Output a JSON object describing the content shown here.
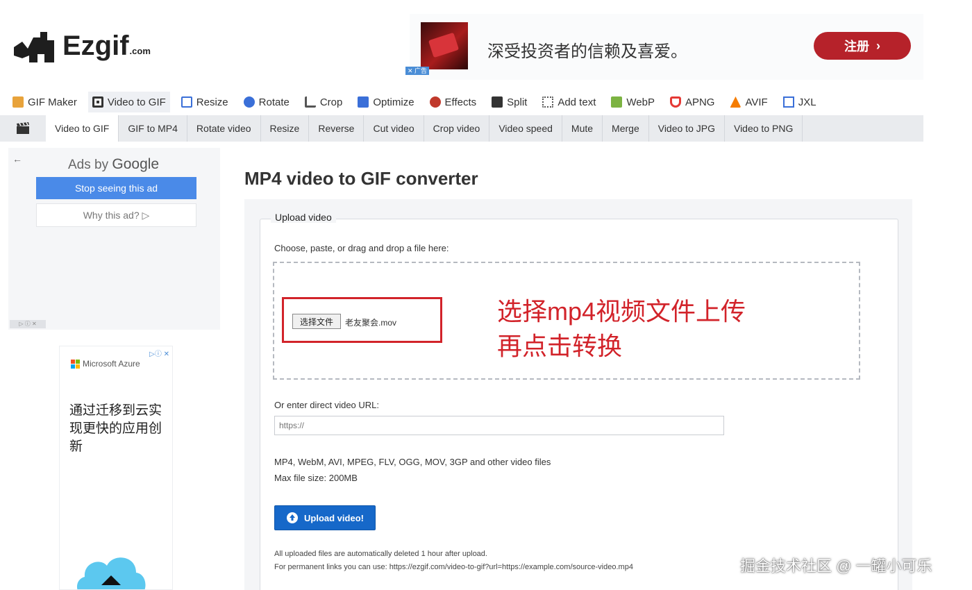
{
  "logo": {
    "name": "Ezgif",
    "suffix": ".com"
  },
  "top_ad": {
    "adchoice": "✕ 广告",
    "text": "深受投资者的信赖及喜爱。",
    "cta": "注册",
    "cta_arrow": "›",
    "cta_color": "#b6222a"
  },
  "main_nav": {
    "items": [
      {
        "label": "GIF Maker",
        "icon": "gif-maker-icon",
        "color": "#e8a33b"
      },
      {
        "label": "Video to GIF",
        "icon": "film-icon",
        "color": "#333333"
      },
      {
        "label": "Resize",
        "icon": "resize-icon",
        "color": "#3a6fd8"
      },
      {
        "label": "Rotate",
        "icon": "rotate-icon",
        "color": "#3a6fd8"
      },
      {
        "label": "Crop",
        "icon": "crop-icon",
        "color": "#555555"
      },
      {
        "label": "Optimize",
        "icon": "optimize-icon",
        "color": "#3a6fd8"
      },
      {
        "label": "Effects",
        "icon": "effects-icon",
        "color": "#c0392b"
      },
      {
        "label": "Split",
        "icon": "split-icon",
        "color": "#333333"
      },
      {
        "label": "Add text",
        "icon": "add-text-icon",
        "color": "#555555"
      },
      {
        "label": "WebP",
        "icon": "webp-icon",
        "color": "#7cb342"
      },
      {
        "label": "APNG",
        "icon": "apng-icon",
        "color": "#e53935"
      },
      {
        "label": "AVIF",
        "icon": "avif-icon",
        "color": "#f57c00"
      },
      {
        "label": "JXL",
        "icon": "jxl-icon",
        "color": "#3a6fd8"
      }
    ]
  },
  "sub_nav": {
    "tabs": [
      "Video to GIF",
      "GIF to MP4",
      "Rotate video",
      "Resize",
      "Reverse",
      "Cut video",
      "Crop video",
      "Video speed",
      "Mute",
      "Merge",
      "Video to JPG",
      "Video to PNG"
    ]
  },
  "google_ad": {
    "back": "←",
    "title_prefix": "Ads by ",
    "title_brand": "Google",
    "stop": "Stop seeing this ad",
    "why": "Why this ad? ▷"
  },
  "azure_ad": {
    "brand": "Microsoft Azure",
    "controls": "▷ⓘ ✕",
    "text": "通过迁移到云实现更快的应用创新"
  },
  "main": {
    "title": "MP4 video to GIF converter",
    "legend": "Upload video",
    "choose_label": "Choose, paste, or drag and drop a file here:",
    "file_button": "选择文件",
    "file_name": "老友聚会.mov",
    "annotation_line1": "选择mp4视频文件上传",
    "annotation_line2": "再点击转换",
    "url_label": "Or enter direct video URL:",
    "url_placeholder": "https://",
    "formats": "MP4, WebM, AVI, MPEG, FLV, OGG, MOV, 3GP and other video files",
    "max_size": "Max file size: 200MB",
    "upload_button": "Upload video!",
    "note1": "All uploaded files are automatically deleted 1 hour after upload.",
    "note2": "For permanent links you can use: https://ezgif.com/video-to-gif?url=https://example.com/source-video.mp4"
  },
  "watermark": "掘金技术社区 @ 一罐小可乐"
}
